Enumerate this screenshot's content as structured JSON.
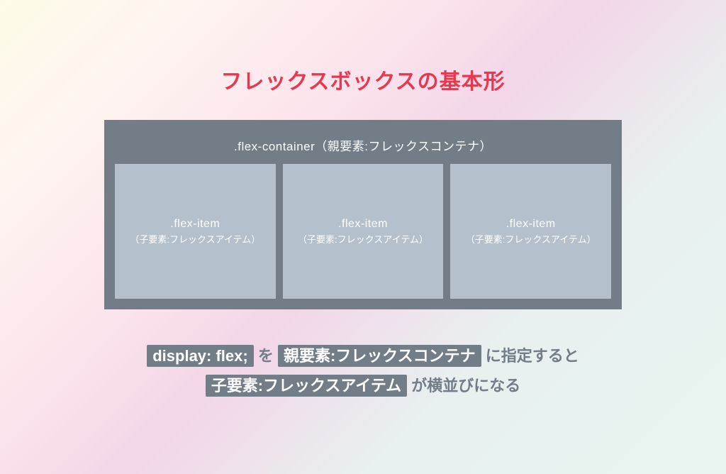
{
  "title": "フレックスボックスの基本形",
  "container": {
    "label": ".flex-container（親要素:フレックスコンテナ）"
  },
  "items": [
    {
      "label": ".flex-item",
      "sub": "（子要素:フレックスアイテム）"
    },
    {
      "label": ".flex-item",
      "sub": "（子要素:フレックスアイテム）"
    },
    {
      "label": ".flex-item",
      "sub": "（子要素:フレックスアイテム）"
    }
  ],
  "description": {
    "chip1": "display: flex;",
    "text1": " を ",
    "chip2": "親要素:フレックスコンテナ",
    "text2": " に指定すると",
    "chip3": "子要素:フレックスアイテム",
    "text3": " が横並びになる"
  }
}
